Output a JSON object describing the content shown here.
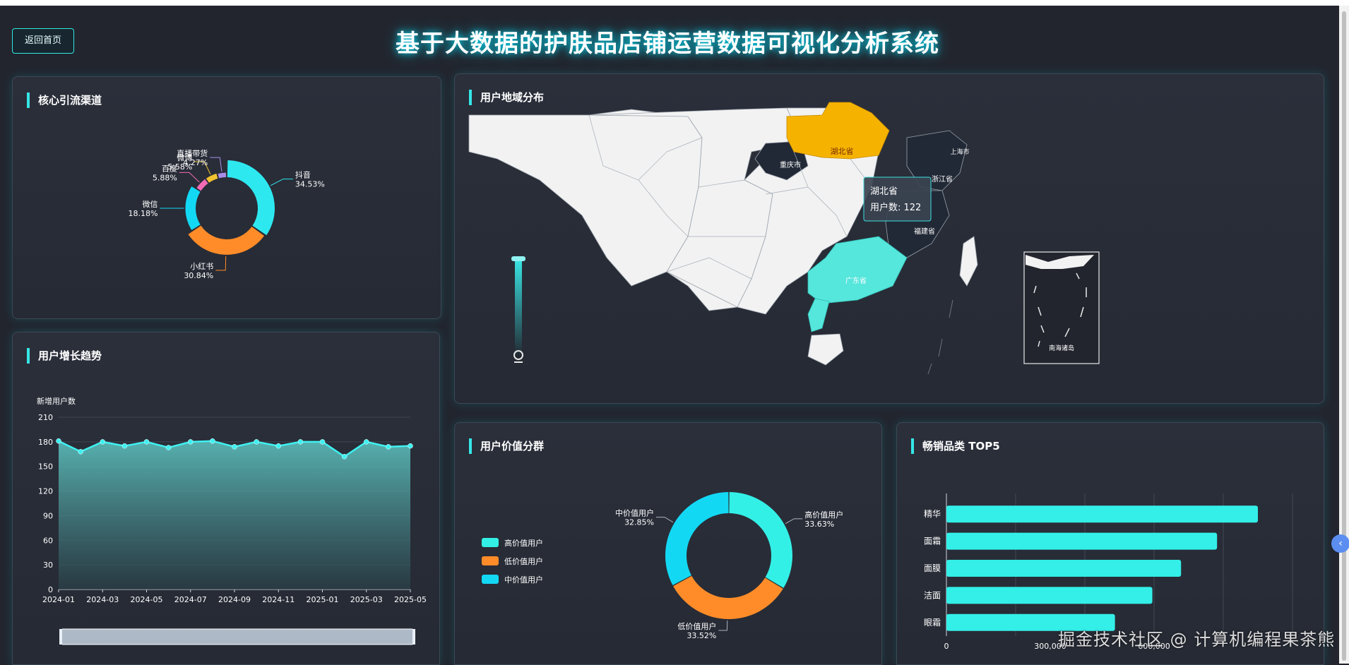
{
  "header": {
    "title": "基于大数据的护肤品店铺运营数据可视化分析系统",
    "back_button": "返回首页"
  },
  "panels": {
    "channels": "核心引流渠道",
    "growth": "用户增长趋势",
    "region": "用户地域分布",
    "value": "用户价值分群",
    "top5": "畅销品类 TOP5"
  },
  "chart_data": [
    {
      "id": "channels",
      "type": "pie",
      "title": "核心引流渠道",
      "slices": [
        {
          "name": "抖音",
          "value": 34.53,
          "label": "34.53%",
          "color": "#2ee8f0"
        },
        {
          "name": "小红书",
          "value": 30.84,
          "label": "30.84%",
          "color": "#ff8c28"
        },
        {
          "name": "微信",
          "value": 18.18,
          "label": "18.18%",
          "color": "#13d8f4"
        },
        {
          "name": "百度",
          "value": 5.88,
          "label": "5.88%",
          "color": "#f26bb4"
        },
        {
          "name": "微博",
          "value": 5.58,
          "label": "5.58%",
          "color": "#f2c230"
        },
        {
          "name": "直播带货",
          "value": 4.27,
          "label": "4.27%",
          "color": "#a98de8"
        }
      ]
    },
    {
      "id": "growth",
      "type": "area",
      "title": "用户增长趋势",
      "ylabel": "新增用户数",
      "ylim": [
        0,
        210
      ],
      "yticks": [
        "0",
        "30",
        "60",
        "90",
        "120",
        "150",
        "180",
        "210"
      ],
      "x_tick_labels": [
        "2024-01",
        "2024-03",
        "2024-05",
        "2024-07",
        "2024-09",
        "2024-11",
        "2025-01",
        "2025-03",
        "2025-05"
      ],
      "x": [
        "2024-01",
        "2024-02",
        "2024-03",
        "2024-04",
        "2024-05",
        "2024-06",
        "2024-07",
        "2024-08",
        "2024-09",
        "2024-10",
        "2024-11",
        "2024-12",
        "2025-01",
        "2025-02",
        "2025-03",
        "2025-04",
        "2025-05"
      ],
      "values": [
        181,
        168,
        180,
        175,
        180,
        173,
        180,
        181,
        174,
        180,
        175,
        180,
        180,
        162,
        180,
        174,
        175
      ],
      "grid": true
    },
    {
      "id": "value",
      "type": "pie",
      "title": "用户价值分群",
      "legend": [
        "高价值用户",
        "低价值用户",
        "中价值用户"
      ],
      "slices": [
        {
          "name": "高价值用户",
          "value": 33.63,
          "label": "33.63%",
          "color": "#33f0e6"
        },
        {
          "name": "低价值用户",
          "value": 33.52,
          "label": "33.52%",
          "color": "#ff8c28"
        },
        {
          "name": "中价值用户",
          "value": 32.85,
          "label": "32.85%",
          "color": "#13d8f4"
        }
      ]
    },
    {
      "id": "top5",
      "type": "bar",
      "orientation": "horizontal",
      "title": "畅销品类 TOP5",
      "categories": [
        "精华",
        "面霜",
        "面膜",
        "洁面",
        "眼霜"
      ],
      "values": [
        900000,
        782000,
        678000,
        595000,
        487000
      ],
      "xticks": [
        "0",
        "300,000",
        "600,000"
      ],
      "xlim": [
        0,
        1000000
      ],
      "color": "#33efe8"
    }
  ],
  "map": {
    "title": "用户地域分布",
    "highlighted": [
      {
        "name": "湖北省",
        "color": "#f5b300"
      },
      {
        "name": "广东省",
        "color": "#55e6dc"
      },
      {
        "name": "重庆市",
        "color": "#222936"
      },
      {
        "name": "浙江省",
        "color": "#222936"
      },
      {
        "name": "福建省",
        "color": "#222936"
      }
    ],
    "labels": [
      "湖北省",
      "重庆市",
      "浙江省",
      "上海市",
      "福建省",
      "广东省",
      "南海诸岛"
    ],
    "tooltip": {
      "region": "湖北省",
      "text": "用户数: 122"
    },
    "visual_map": {
      "gradient_top": "#39e6e6",
      "gradient_bottom": "#22252e"
    }
  },
  "watermark": "掘金技术社区 @ 计算机编程果茶熊",
  "icons": {
    "float_button": "chevron-left-icon"
  }
}
